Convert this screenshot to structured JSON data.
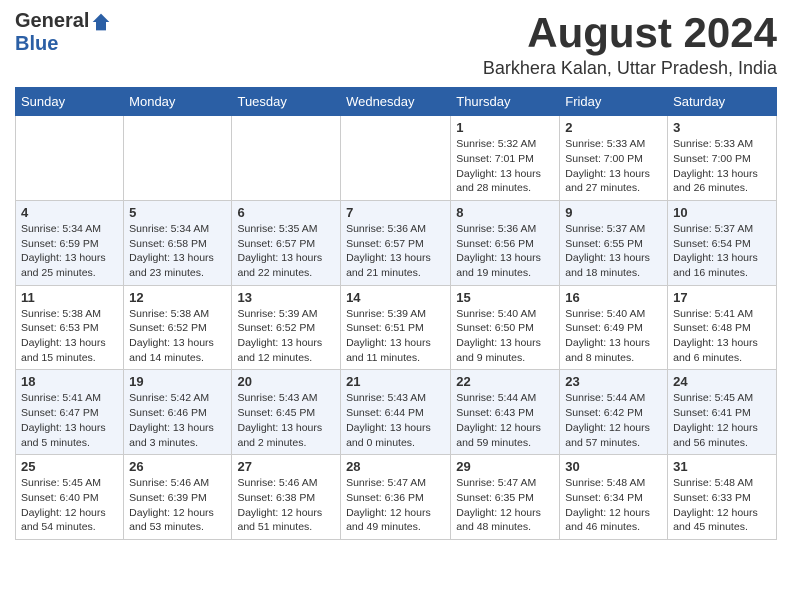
{
  "header": {
    "logo_general": "General",
    "logo_blue": "Blue",
    "month_title": "August 2024",
    "location": "Barkhera Kalan, Uttar Pradesh, India"
  },
  "weekdays": [
    "Sunday",
    "Monday",
    "Tuesday",
    "Wednesday",
    "Thursday",
    "Friday",
    "Saturday"
  ],
  "weeks": [
    [
      {
        "day": "",
        "info": ""
      },
      {
        "day": "",
        "info": ""
      },
      {
        "day": "",
        "info": ""
      },
      {
        "day": "",
        "info": ""
      },
      {
        "day": "1",
        "info": "Sunrise: 5:32 AM\nSunset: 7:01 PM\nDaylight: 13 hours\nand 28 minutes."
      },
      {
        "day": "2",
        "info": "Sunrise: 5:33 AM\nSunset: 7:00 PM\nDaylight: 13 hours\nand 27 minutes."
      },
      {
        "day": "3",
        "info": "Sunrise: 5:33 AM\nSunset: 7:00 PM\nDaylight: 13 hours\nand 26 minutes."
      }
    ],
    [
      {
        "day": "4",
        "info": "Sunrise: 5:34 AM\nSunset: 6:59 PM\nDaylight: 13 hours\nand 25 minutes."
      },
      {
        "day": "5",
        "info": "Sunrise: 5:34 AM\nSunset: 6:58 PM\nDaylight: 13 hours\nand 23 minutes."
      },
      {
        "day": "6",
        "info": "Sunrise: 5:35 AM\nSunset: 6:57 PM\nDaylight: 13 hours\nand 22 minutes."
      },
      {
        "day": "7",
        "info": "Sunrise: 5:36 AM\nSunset: 6:57 PM\nDaylight: 13 hours\nand 21 minutes."
      },
      {
        "day": "8",
        "info": "Sunrise: 5:36 AM\nSunset: 6:56 PM\nDaylight: 13 hours\nand 19 minutes."
      },
      {
        "day": "9",
        "info": "Sunrise: 5:37 AM\nSunset: 6:55 PM\nDaylight: 13 hours\nand 18 minutes."
      },
      {
        "day": "10",
        "info": "Sunrise: 5:37 AM\nSunset: 6:54 PM\nDaylight: 13 hours\nand 16 minutes."
      }
    ],
    [
      {
        "day": "11",
        "info": "Sunrise: 5:38 AM\nSunset: 6:53 PM\nDaylight: 13 hours\nand 15 minutes."
      },
      {
        "day": "12",
        "info": "Sunrise: 5:38 AM\nSunset: 6:52 PM\nDaylight: 13 hours\nand 14 minutes."
      },
      {
        "day": "13",
        "info": "Sunrise: 5:39 AM\nSunset: 6:52 PM\nDaylight: 13 hours\nand 12 minutes."
      },
      {
        "day": "14",
        "info": "Sunrise: 5:39 AM\nSunset: 6:51 PM\nDaylight: 13 hours\nand 11 minutes."
      },
      {
        "day": "15",
        "info": "Sunrise: 5:40 AM\nSunset: 6:50 PM\nDaylight: 13 hours\nand 9 minutes."
      },
      {
        "day": "16",
        "info": "Sunrise: 5:40 AM\nSunset: 6:49 PM\nDaylight: 13 hours\nand 8 minutes."
      },
      {
        "day": "17",
        "info": "Sunrise: 5:41 AM\nSunset: 6:48 PM\nDaylight: 13 hours\nand 6 minutes."
      }
    ],
    [
      {
        "day": "18",
        "info": "Sunrise: 5:41 AM\nSunset: 6:47 PM\nDaylight: 13 hours\nand 5 minutes."
      },
      {
        "day": "19",
        "info": "Sunrise: 5:42 AM\nSunset: 6:46 PM\nDaylight: 13 hours\nand 3 minutes."
      },
      {
        "day": "20",
        "info": "Sunrise: 5:43 AM\nSunset: 6:45 PM\nDaylight: 13 hours\nand 2 minutes."
      },
      {
        "day": "21",
        "info": "Sunrise: 5:43 AM\nSunset: 6:44 PM\nDaylight: 13 hours\nand 0 minutes."
      },
      {
        "day": "22",
        "info": "Sunrise: 5:44 AM\nSunset: 6:43 PM\nDaylight: 12 hours\nand 59 minutes."
      },
      {
        "day": "23",
        "info": "Sunrise: 5:44 AM\nSunset: 6:42 PM\nDaylight: 12 hours\nand 57 minutes."
      },
      {
        "day": "24",
        "info": "Sunrise: 5:45 AM\nSunset: 6:41 PM\nDaylight: 12 hours\nand 56 minutes."
      }
    ],
    [
      {
        "day": "25",
        "info": "Sunrise: 5:45 AM\nSunset: 6:40 PM\nDaylight: 12 hours\nand 54 minutes."
      },
      {
        "day": "26",
        "info": "Sunrise: 5:46 AM\nSunset: 6:39 PM\nDaylight: 12 hours\nand 53 minutes."
      },
      {
        "day": "27",
        "info": "Sunrise: 5:46 AM\nSunset: 6:38 PM\nDaylight: 12 hours\nand 51 minutes."
      },
      {
        "day": "28",
        "info": "Sunrise: 5:47 AM\nSunset: 6:36 PM\nDaylight: 12 hours\nand 49 minutes."
      },
      {
        "day": "29",
        "info": "Sunrise: 5:47 AM\nSunset: 6:35 PM\nDaylight: 12 hours\nand 48 minutes."
      },
      {
        "day": "30",
        "info": "Sunrise: 5:48 AM\nSunset: 6:34 PM\nDaylight: 12 hours\nand 46 minutes."
      },
      {
        "day": "31",
        "info": "Sunrise: 5:48 AM\nSunset: 6:33 PM\nDaylight: 12 hours\nand 45 minutes."
      }
    ]
  ]
}
